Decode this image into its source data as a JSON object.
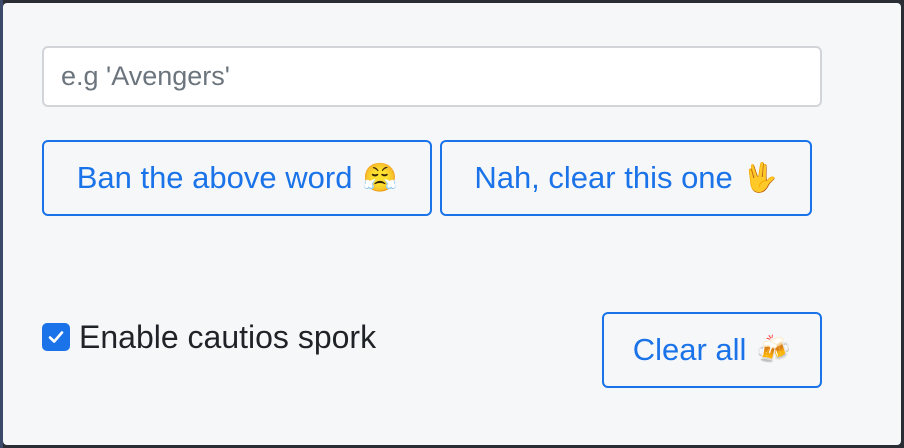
{
  "input": {
    "placeholder": "e.g 'Avengers'",
    "value": ""
  },
  "buttons": {
    "ban": {
      "label": "Ban the above word",
      "emoji": "😤",
      "icon": "face-with-steam-icon"
    },
    "clear_one": {
      "label": "Nah, clear this one",
      "emoji": "🖖",
      "icon": "vulcan-salute-icon"
    },
    "clear_all": {
      "label": "Clear all",
      "emoji": "🍻",
      "icon": "clinking-beer-mugs-icon"
    }
  },
  "options": {
    "cautious_spork": {
      "label": "Enable cautios spork",
      "checked": true
    }
  },
  "colors": {
    "accent": "#1a73e8",
    "panel_bg": "#f6f7f9",
    "input_border": "#d1d5da"
  }
}
